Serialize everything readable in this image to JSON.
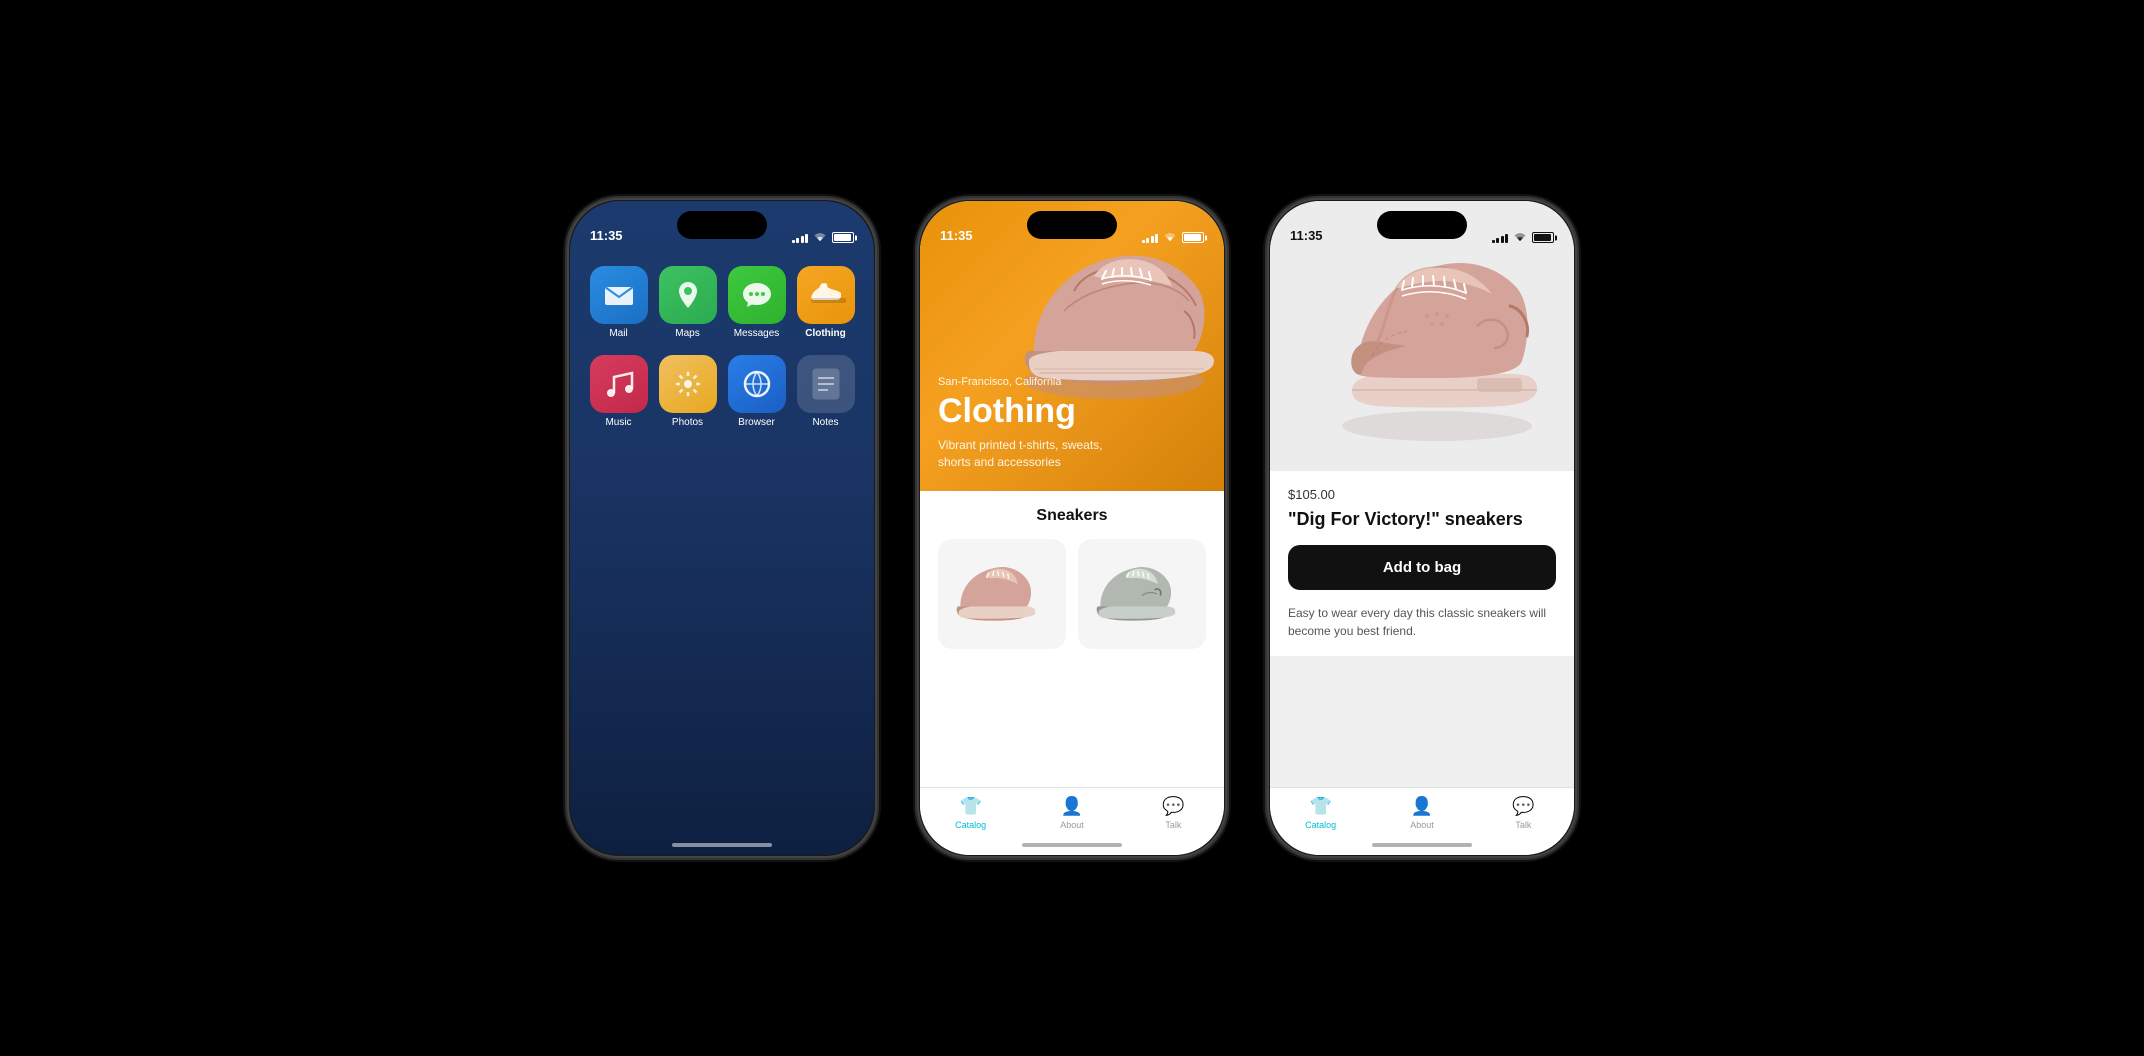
{
  "phone1": {
    "status": {
      "time": "11:35"
    },
    "apps": [
      {
        "id": "mail",
        "label": "Mail",
        "icon_type": "mail",
        "highlighted": false
      },
      {
        "id": "maps",
        "label": "Maps",
        "icon_type": "maps",
        "highlighted": false
      },
      {
        "id": "messages",
        "label": "Messages",
        "icon_type": "messages",
        "highlighted": false
      },
      {
        "id": "clothing",
        "label": "Clothing",
        "icon_type": "clothing",
        "highlighted": true
      },
      {
        "id": "music",
        "label": "Music",
        "icon_type": "music",
        "highlighted": false
      },
      {
        "id": "photos",
        "label": "Photos",
        "icon_type": "photos",
        "highlighted": false
      },
      {
        "id": "browser",
        "label": "Browser",
        "icon_type": "browser",
        "highlighted": false
      },
      {
        "id": "notes",
        "label": "Notes",
        "icon_type": "notes",
        "highlighted": false
      }
    ]
  },
  "phone2": {
    "status": {
      "time": "11:35"
    },
    "hero": {
      "location": "San-Francisco, California",
      "title": "Clothing",
      "subtitle": "Vibrant printed t-shirts, sweats, shorts and accessories"
    },
    "section_title": "Sneakers",
    "tabs": [
      {
        "id": "catalog",
        "label": "Catalog",
        "icon": "👕",
        "active": true
      },
      {
        "id": "about",
        "label": "About",
        "icon": "👤",
        "active": false
      },
      {
        "id": "talk",
        "label": "Talk",
        "icon": "💬",
        "active": false
      }
    ]
  },
  "phone3": {
    "status": {
      "time": "11:35"
    },
    "product": {
      "price": "$105.00",
      "name": "\"Dig For Victory!\" sneakers",
      "add_to_bag": "Add to bag",
      "description": "Easy to wear every day this classic sneakers will become you best friend."
    },
    "tabs": [
      {
        "id": "catalog",
        "label": "Catalog",
        "icon": "👕",
        "active": true
      },
      {
        "id": "about",
        "label": "About",
        "icon": "👤",
        "active": false
      },
      {
        "id": "talk",
        "label": "Talk",
        "icon": "💬",
        "active": false
      }
    ]
  },
  "colors": {
    "accent": "#00bcd4",
    "orange": "#f0a020",
    "dark": "#111111",
    "tab_active": "#00bcd4",
    "tab_inactive": "#999999"
  }
}
